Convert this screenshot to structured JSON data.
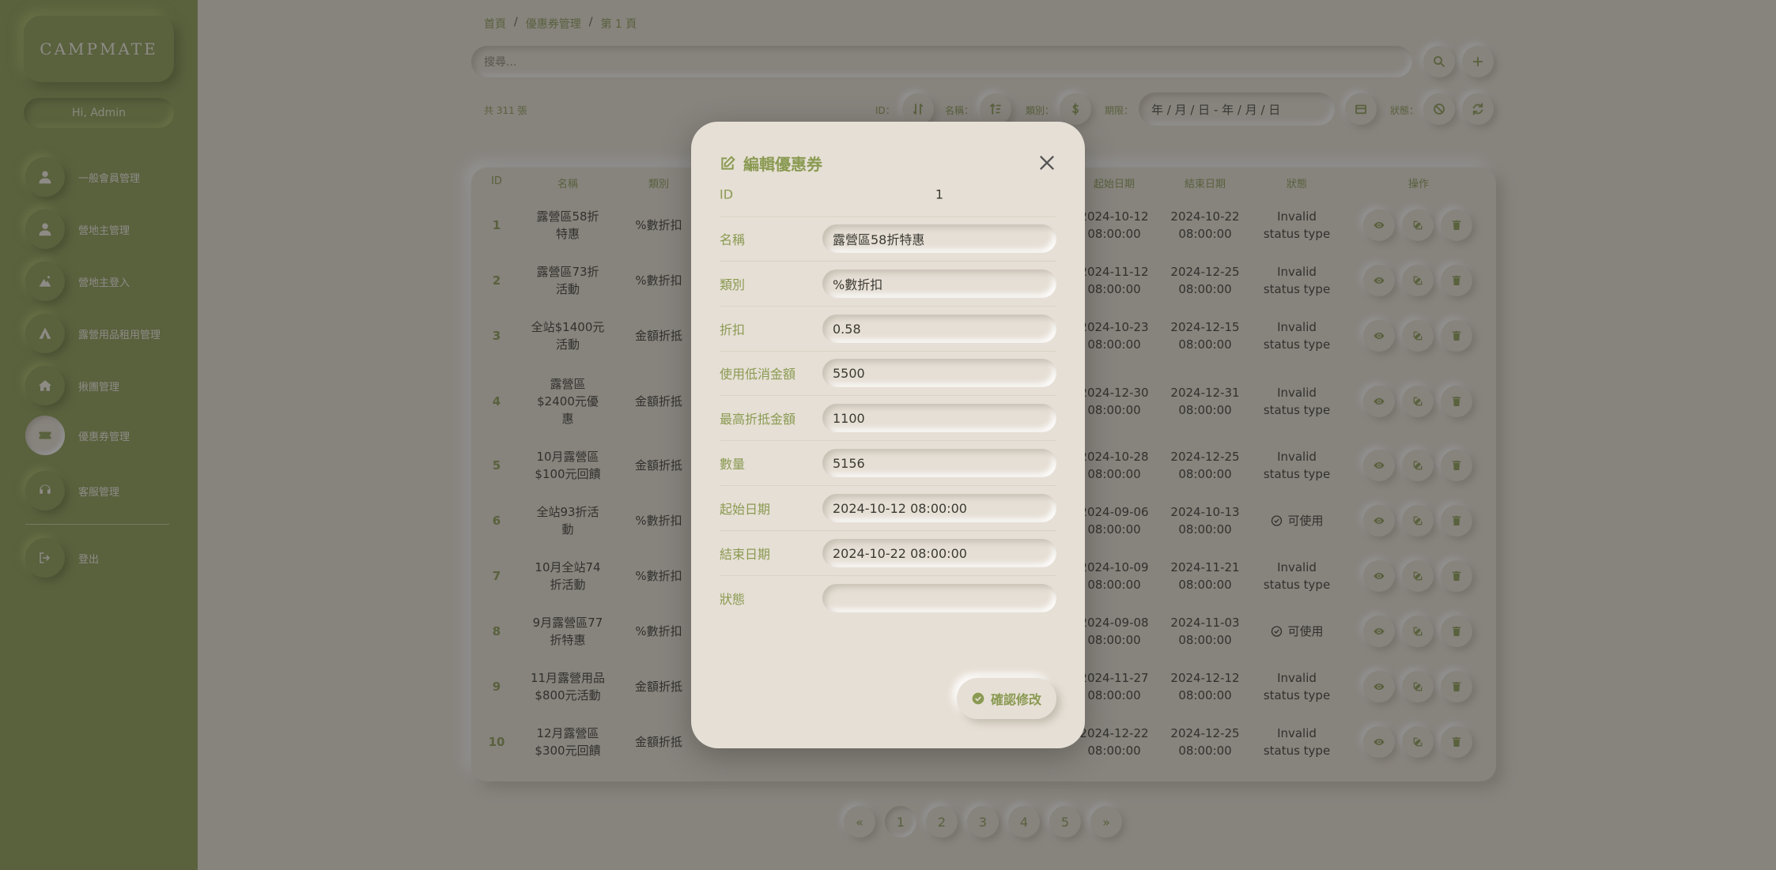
{
  "app": {
    "logo": "CAMPMATE",
    "greeting": "Hi, Admin"
  },
  "sidebar": {
    "items": [
      {
        "label": "一般會員管理",
        "icon": "user-icon"
      },
      {
        "label": "營地主管理",
        "icon": "user-icon"
      },
      {
        "label": "營地主登入",
        "icon": "campsite-icon"
      },
      {
        "label": "露營用品租用管理",
        "icon": "tent-icon"
      },
      {
        "label": "揪團管理",
        "icon": "group-tent-icon"
      },
      {
        "label": "優惠券管理",
        "icon": "coupon-icon"
      },
      {
        "label": "客服管理",
        "icon": "headset-icon"
      }
    ],
    "logout": "登出"
  },
  "breadcrumb": [
    "首頁",
    "優惠券管理",
    "第 1 頁"
  ],
  "search": {
    "placeholder": "搜尋..."
  },
  "toolbar": {
    "total": "共 311 張",
    "id_label": "ID：",
    "name_label": "名稱：",
    "type_label": "類別：",
    "period_label": "期限：",
    "date_range": "年 / 月 / 日 - 年 / 月 / 日",
    "status_label": "狀態："
  },
  "table": {
    "headers": [
      "ID",
      "名稱",
      "類別",
      "起始日期",
      "結束日期",
      "狀態",
      "操作"
    ],
    "rows": [
      {
        "id": "1",
        "name": "露營區58折\n特惠",
        "type": "%數折扣",
        "start": "2024-10-12\n08:00:00",
        "end": "2024-10-22\n08:00:00",
        "status": "Invalid\nstatus type",
        "ok": false
      },
      {
        "id": "2",
        "name": "露營區73折\n活動",
        "type": "%數折扣",
        "start": "2024-11-12\n08:00:00",
        "end": "2024-12-25\n08:00:00",
        "status": "Invalid\nstatus type",
        "ok": false
      },
      {
        "id": "3",
        "name": "全站$1400元\n活動",
        "type": "金額折抵",
        "start": "2024-10-23\n08:00:00",
        "end": "2024-12-15\n08:00:00",
        "status": "Invalid\nstatus type",
        "ok": false
      },
      {
        "id": "4",
        "name": "露營區\n$2400元優\n惠",
        "type": "金額折抵",
        "start": "2024-12-30\n08:00:00",
        "end": "2024-12-31\n08:00:00",
        "status": "Invalid\nstatus type",
        "ok": false
      },
      {
        "id": "5",
        "name": "10月露營區\n$100元回饋",
        "type": "金額折抵",
        "start": "2024-10-28\n08:00:00",
        "end": "2024-12-25\n08:00:00",
        "status": "Invalid\nstatus type",
        "ok": false
      },
      {
        "id": "6",
        "name": "全站93折活\n動",
        "type": "%數折扣",
        "start": "2024-09-06\n08:00:00",
        "end": "2024-10-13\n08:00:00",
        "status": "可使用",
        "ok": true
      },
      {
        "id": "7",
        "name": "10月全站74\n折活動",
        "type": "%數折扣",
        "start": "2024-10-09\n08:00:00",
        "end": "2024-11-21\n08:00:00",
        "status": "Invalid\nstatus type",
        "ok": false
      },
      {
        "id": "8",
        "name": "9月露營區77\n折特惠",
        "type": "%數折扣",
        "start": "2024-09-08\n08:00:00",
        "end": "2024-11-03\n08:00:00",
        "status": "可使用",
        "ok": true
      },
      {
        "id": "9",
        "name": "11月露營用品\n$800元活動",
        "type": "金額折抵",
        "start": "2024-11-27\n08:00:00",
        "end": "2024-12-12\n08:00:00",
        "status": "Invalid\nstatus type",
        "ok": false
      },
      {
        "id": "10",
        "name": "12月露營區\n$300元回饋",
        "type": "金額折抵",
        "start": "2024-12-22\n08:00:00",
        "end": "2024-12-25\n08:00:00",
        "status": "Invalid\nstatus type",
        "ok": false
      }
    ]
  },
  "pagination": [
    "«",
    "1",
    "2",
    "3",
    "4",
    "5",
    "»"
  ],
  "modal": {
    "title": "編輯優惠券",
    "fields": [
      {
        "label": "ID",
        "value": "1",
        "readonly": true
      },
      {
        "label": "名稱",
        "value": "露營區58折特惠"
      },
      {
        "label": "類別",
        "value": "%數折扣"
      },
      {
        "label": "折扣",
        "value": "0.58"
      },
      {
        "label": "使用低消金額",
        "value": "5500"
      },
      {
        "label": "最高折抵金額",
        "value": "1100"
      },
      {
        "label": "數量",
        "value": "5156"
      },
      {
        "label": "起始日期",
        "value": "2024-10-12 08:00:00"
      },
      {
        "label": "結束日期",
        "value": "2024-10-22 08:00:00"
      },
      {
        "label": "狀態",
        "value": ""
      }
    ],
    "confirm": "確認修改"
  },
  "colors": {
    "accent": "#8a9a52",
    "background": "#e6ded3",
    "sidebar": "#8a9a52"
  }
}
